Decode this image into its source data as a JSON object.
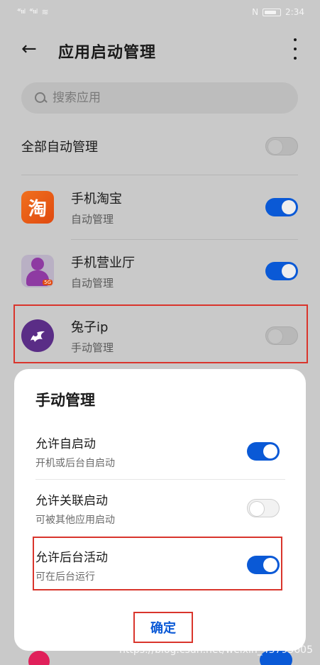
{
  "status_bar": {
    "time": "2:34",
    "signal1": "⁴⁶ıııl",
    "signal2": "⁴⁶ıııl",
    "wifi": "≋",
    "nfc": "N"
  },
  "header": {
    "title": "应用启动管理"
  },
  "search": {
    "placeholder": "搜索应用"
  },
  "all_manage": {
    "label": "全部自动管理",
    "enabled": false
  },
  "apps": [
    {
      "name": "手机淘宝",
      "status": "自动管理",
      "enabled": true,
      "icon": "taobao-icon",
      "icon_text": "淘"
    },
    {
      "name": "手机营业厅",
      "status": "自动管理",
      "enabled": true,
      "icon": "unicom-hall-icon",
      "badge": "5G"
    },
    {
      "name": "兔子ip",
      "status": "手动管理",
      "enabled": false,
      "icon": "rabbit-ip-icon"
    }
  ],
  "dialog": {
    "title": "手动管理",
    "options": [
      {
        "name": "允许自启动",
        "desc": "开机或后台自启动",
        "enabled": true
      },
      {
        "name": "允许关联启动",
        "desc": "可被其他应用启动",
        "enabled": false
      },
      {
        "name": "允许后台活动",
        "desc": "可在后台运行",
        "enabled": true
      }
    ],
    "confirm": "确定"
  },
  "watermark": "https://blog.csdn.net/weixin_43795605",
  "colors": {
    "accent": "#0a59d6",
    "highlight": "#d9352c"
  }
}
